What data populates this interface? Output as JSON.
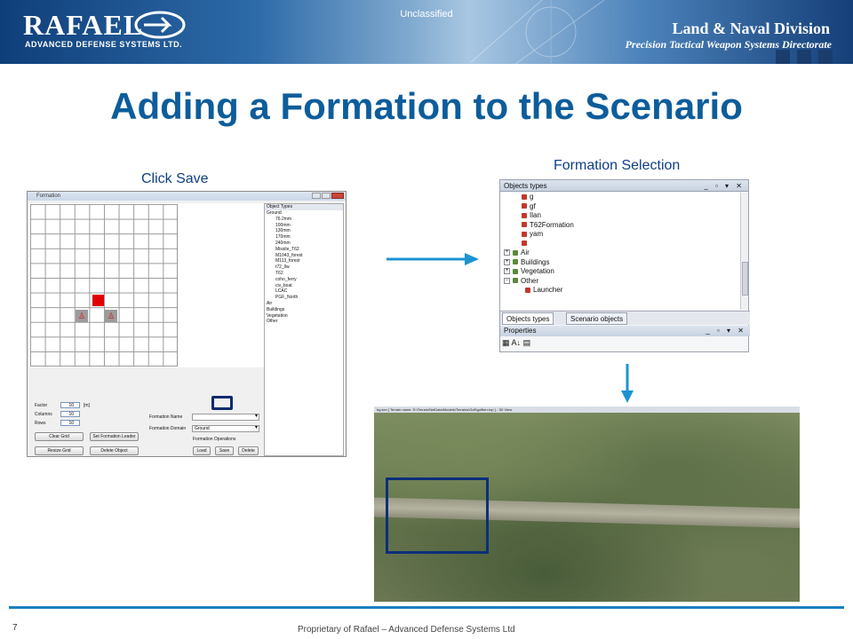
{
  "header": {
    "brand": "RAFAEL",
    "brand_sub": "ADVANCED DEFENSE SYSTEMS LTD.",
    "classification": "Unclassified",
    "division": "Land & Naval Division",
    "directorate": "Precision Tactical Weapon Systems Directorate"
  },
  "slide": {
    "title": "Adding a Formation to the Scenario",
    "caption_left": "Click Save",
    "caption_right": "Formation Selection"
  },
  "formation_window": {
    "title": "Formation",
    "tree_header": "Object Types",
    "tree_items": [
      "Ground",
      "76.2mm",
      "100mm",
      "130mm",
      "170mm",
      "240mm",
      "Missile_T62",
      "M1043_forest",
      "M113_forest",
      "t72_llw",
      "T62",
      "coho_ferry",
      "civ_boat",
      "LCAC",
      "PGF_North",
      "Air",
      "Buildings",
      "Vegetation",
      "Other"
    ],
    "factor_label": "Factor",
    "factor_value": "10",
    "factor_unit": "[m]",
    "columns_label": "Columns",
    "columns_value": "10",
    "rows_label": "Rows",
    "rows_value": "10",
    "formation_name_label": "Formation Name",
    "formation_domain_label": "Formation Domain",
    "formation_domain_value": "Ground",
    "formation_operations_label": "Formation Operations",
    "clear_grid": "Clear Grid",
    "set_leader": "Set Formation Leader",
    "resize_grid": "Resize Grid",
    "delete_object": "Delete Object",
    "load": "Load",
    "save": "Save",
    "delete": "Delete"
  },
  "objects_panel": {
    "title": "Objects types",
    "items": [
      {
        "label": "g",
        "level": 2
      },
      {
        "label": "gf",
        "level": 2
      },
      {
        "label": "Ilan",
        "level": 2
      },
      {
        "label": "T62Formation",
        "level": 2
      },
      {
        "label": "yam",
        "level": 2
      },
      {
        "label": "",
        "level": 2
      },
      {
        "label": "Air",
        "level": 0
      },
      {
        "label": "Buildings",
        "level": 0
      },
      {
        "label": "Vegetation",
        "level": 0
      },
      {
        "label": "Other",
        "level": 0
      },
      {
        "label": "Launcher",
        "level": 1
      }
    ],
    "tab_objects": "Objects types",
    "tab_scenario": "Scenario objects",
    "properties_title": "Properties"
  },
  "view3d": {
    "title_bar": "bg.scn [ Terrain name: D:\\Terrain\\NetData\\Models\\Terrains\\Golf\\golfterr.top ] - 3D View"
  },
  "footer": {
    "page_number": "7",
    "text": "Proprietary of Rafael – Advanced Defense Systems Ltd"
  },
  "colors": {
    "title": "#0d5d9b",
    "caption": "#0e3f85",
    "accent_line": "#1a7fc1",
    "arrow": "#1c94d2",
    "highlight_box": "#0a2a6e"
  }
}
